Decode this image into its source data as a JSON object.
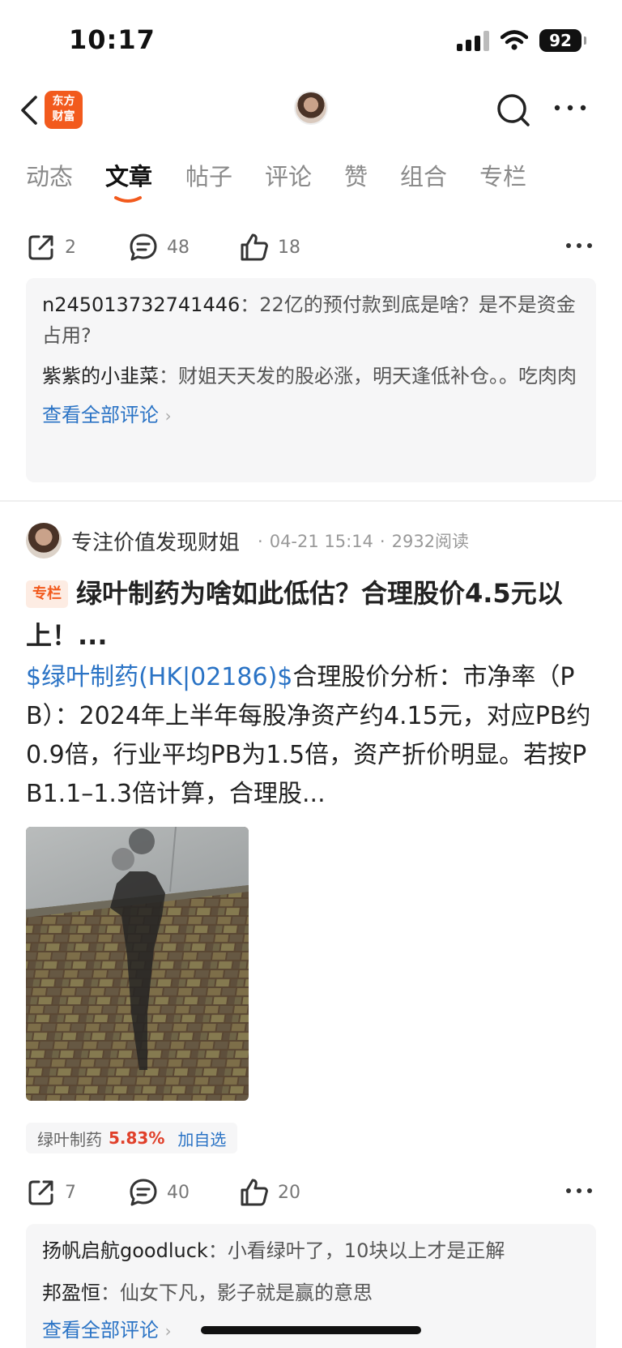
{
  "status_bar": {
    "time": "10:17",
    "battery": "92"
  },
  "nav": {
    "logo_line1": "东方",
    "logo_line2": "财富"
  },
  "tabs": [
    "动态",
    "文章",
    "帖子",
    "评论",
    "赞",
    "组合",
    "专栏"
  ],
  "active_tab": "文章",
  "post1": {
    "share_count": "2",
    "comment_count": "48",
    "like_count": "18",
    "comments": [
      {
        "user": "n245013732741446",
        "sep": "：",
        "text": "22亿的预付款到底是啥？是不是资金占用?"
      },
      {
        "user": "紫紫的小韭菜",
        "sep": "：",
        "text": "财姐天天发的股必涨，明天逢低补仓。。吃肉肉"
      }
    ],
    "view_all": "查看全部评论"
  },
  "post2": {
    "author": "专注价值发现财姐",
    "date": "04-21 15:14",
    "reads": "2932阅读",
    "tag": "专栏",
    "title": "绿叶制药为啥如此低估？合理股价4.5元以上！...",
    "body_link": "$绿叶制药(HK|02186)$",
    "body_text": "合理股价分析：市净率（PB）：2024年上半年每股净资产约4.15元，对应PB约0.9倍，行业平均PB为1.5倍，资产折价明显。若按PB1.1–1.3倍计算，合理股...",
    "stock": {
      "name": "绿叶制药",
      "change": "5.83%",
      "add": "加自选"
    },
    "share_count": "7",
    "comment_count": "40",
    "like_count": "20",
    "comments": [
      {
        "user": "扬帆启航goodluck",
        "sep": "：",
        "text": "小看绿叶了，10块以上才是正解"
      },
      {
        "user": "邦盈恒",
        "sep": "：",
        "text": "仙女下凡，影子就是赢的意思"
      }
    ],
    "view_all": "查看全部评论"
  },
  "colors": {
    "accent": "#f25a1d",
    "link": "#2a73c5",
    "up": "#e0402a"
  }
}
